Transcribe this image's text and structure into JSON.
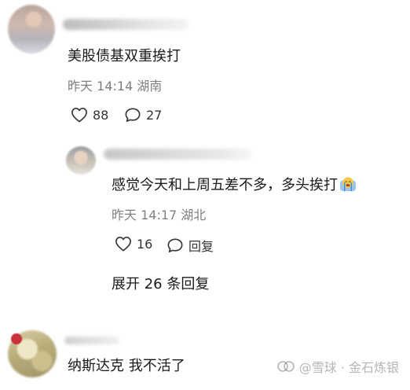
{
  "comments": [
    {
      "text": "美股债基双重挨打",
      "time": "昨天 14:14",
      "location": "湖南",
      "likes": "88",
      "replies": "27"
    }
  ],
  "reply": {
    "text": "感觉今天和上周五差不多，多头挨打",
    "time": "昨天 14:17",
    "location": "湖北",
    "likes": "16",
    "reply_label": "回复"
  },
  "expand_label": "展开 26 条回复",
  "third_comment": {
    "text": "纳斯达克 我不活了"
  },
  "watermark": {
    "text": "@雪球 · 金石炼银"
  },
  "icons": {
    "like": "heart-outline-icon",
    "comment": "speech-bubble-icon",
    "emoji": "crying-face-emoji-icon",
    "watermark_logo": "snowball-logo-icon"
  },
  "colors": {
    "text": "#1a1a1a",
    "meta": "#7f7f7f",
    "background": "#ffffff"
  }
}
